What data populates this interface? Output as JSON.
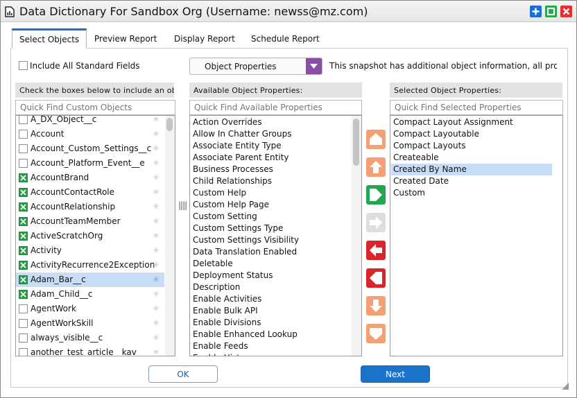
{
  "window": {
    "title": "Data Dictionary For Sandbox Org (Username: newss@mz.com)",
    "title_icon": "document-chart-icon",
    "controls": [
      "maximize-icon",
      "restore-icon",
      "close-icon"
    ]
  },
  "tabs": [
    {
      "label": "Select Objects",
      "active": true
    },
    {
      "label": "Preview Report",
      "active": false
    },
    {
      "label": "Display Report",
      "active": false
    },
    {
      "label": "Schedule Report",
      "active": false
    }
  ],
  "options": {
    "include_standard_label": "Include All Standard Fields",
    "include_standard_checked": false,
    "dropdown_value": "Object Properties",
    "info_text": "This snapshot has additional object information, all properties"
  },
  "objects_panel": {
    "header": "Check the boxes below to include an object",
    "search_placeholder": "Quick Find Custom Objects",
    "items": [
      {
        "name": "A_DX_Object__c",
        "checked": false,
        "selected": false
      },
      {
        "name": "Account",
        "checked": false,
        "selected": false
      },
      {
        "name": "Account_Custom_Settings__c",
        "checked": false,
        "selected": false
      },
      {
        "name": "Account_Platform_Event__e",
        "checked": false,
        "selected": false
      },
      {
        "name": "AccountBrand",
        "checked": true,
        "selected": false
      },
      {
        "name": "AccountContactRole",
        "checked": true,
        "selected": false
      },
      {
        "name": "AccountRelationship",
        "checked": true,
        "selected": false
      },
      {
        "name": "AccountTeamMember",
        "checked": true,
        "selected": false
      },
      {
        "name": "ActiveScratchOrg",
        "checked": true,
        "selected": false
      },
      {
        "name": "Activity",
        "checked": true,
        "selected": false
      },
      {
        "name": "ActivityRecurrence2Exception",
        "checked": true,
        "selected": false
      },
      {
        "name": "Adam_Bar__c",
        "checked": true,
        "selected": true
      },
      {
        "name": "Adam_Child__c",
        "checked": true,
        "selected": false
      },
      {
        "name": "AgentWork",
        "checked": false,
        "selected": false
      },
      {
        "name": "AgentWorkSkill",
        "checked": false,
        "selected": false
      },
      {
        "name": "always_visible__c",
        "checked": false,
        "selected": false
      },
      {
        "name": "another_test_article__kav",
        "checked": false,
        "selected": false
      }
    ],
    "star_glyph": "✳"
  },
  "available_panel": {
    "header": "Available Object Properties:",
    "search_placeholder": "Quick Find Available Properties",
    "items": [
      "Action Overrides",
      "Allow In Chatter Groups",
      "Associate Entity Type",
      "Associate Parent Entity",
      "Business Processes",
      "Child Relationships",
      "Custom Help",
      "Custom Help Page",
      "Custom Setting",
      "Custom Settings Type",
      "Custom Settings Visibility",
      "Data Translation Enabled",
      "Deletable",
      "Deployment Status",
      "Description",
      "Enable Activities",
      "Enable Bulk API",
      "Enable Divisions",
      "Enable Enhanced Lookup",
      "Enable Feeds",
      "Enable History"
    ]
  },
  "transfer_buttons": [
    {
      "name": "move-top-button",
      "icon": "arrow-top-icon",
      "color": "#f59f74"
    },
    {
      "name": "move-up-button",
      "icon": "arrow-up-icon",
      "color": "#f59f74"
    },
    {
      "name": "add-all-button",
      "icon": "double-right-icon",
      "color": "#22a750"
    },
    {
      "name": "add-button",
      "icon": "arrow-right-icon",
      "color": "#dedede"
    },
    {
      "name": "remove-button",
      "icon": "arrow-left-icon",
      "color": "#d9262b"
    },
    {
      "name": "remove-all-button",
      "icon": "double-left-icon",
      "color": "#d9262b"
    },
    {
      "name": "move-down-button",
      "icon": "arrow-down-icon",
      "color": "#f59f74"
    },
    {
      "name": "move-bottom-button",
      "icon": "arrow-bottom-icon",
      "color": "#f59f74"
    }
  ],
  "selected_panel": {
    "header": "Selected Object Properties:",
    "search_placeholder": "Quick Find Selected Properties",
    "items": [
      {
        "name": "Compact Layout Assignment",
        "selected": false
      },
      {
        "name": "Compact Layoutable",
        "selected": false
      },
      {
        "name": "Compact Layouts",
        "selected": false
      },
      {
        "name": "Createable",
        "selected": false
      },
      {
        "name": "Created By Name",
        "selected": true
      },
      {
        "name": "Created Date",
        "selected": false
      },
      {
        "name": "Custom",
        "selected": false
      }
    ]
  },
  "footer": {
    "ok_label": "OK",
    "next_label": "Next"
  },
  "colors": {
    "accent": "#1b73c9",
    "tab_indicator": "#1b6fc6",
    "checkbox_on": "#26a046",
    "dropdown_arrow": "#8a4ea6",
    "selection": "#c7ddf5"
  }
}
